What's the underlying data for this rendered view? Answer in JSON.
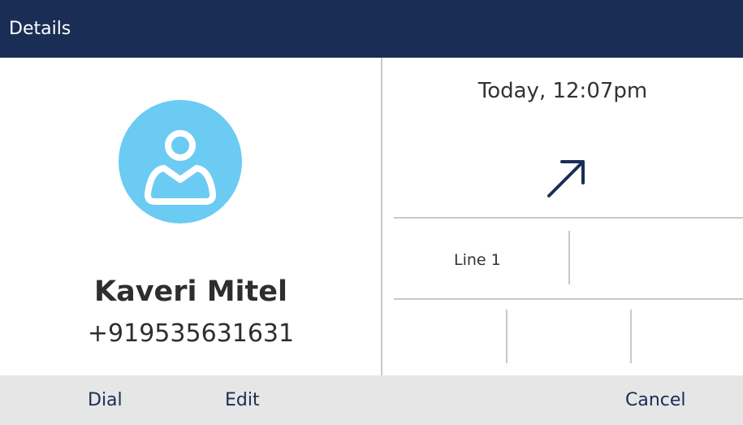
{
  "header": {
    "title": "Details"
  },
  "contact": {
    "name": "Kaveri Mitel",
    "number": "+919535631631",
    "avatar_icon": "person-icon",
    "avatar_color": "#6bcbf3"
  },
  "call": {
    "timestamp": "Today, 12:07pm",
    "direction_icon": "outgoing-arrow-icon",
    "line": "Line 1"
  },
  "softkeys": {
    "dial": "Dial",
    "edit": "Edit",
    "cancel": "Cancel"
  },
  "colors": {
    "header_bg": "#1a2e55",
    "softkey_bar_bg": "#e6e6e6",
    "softkey_text": "#1a2e55",
    "accent_icon": "#1a2e55"
  }
}
